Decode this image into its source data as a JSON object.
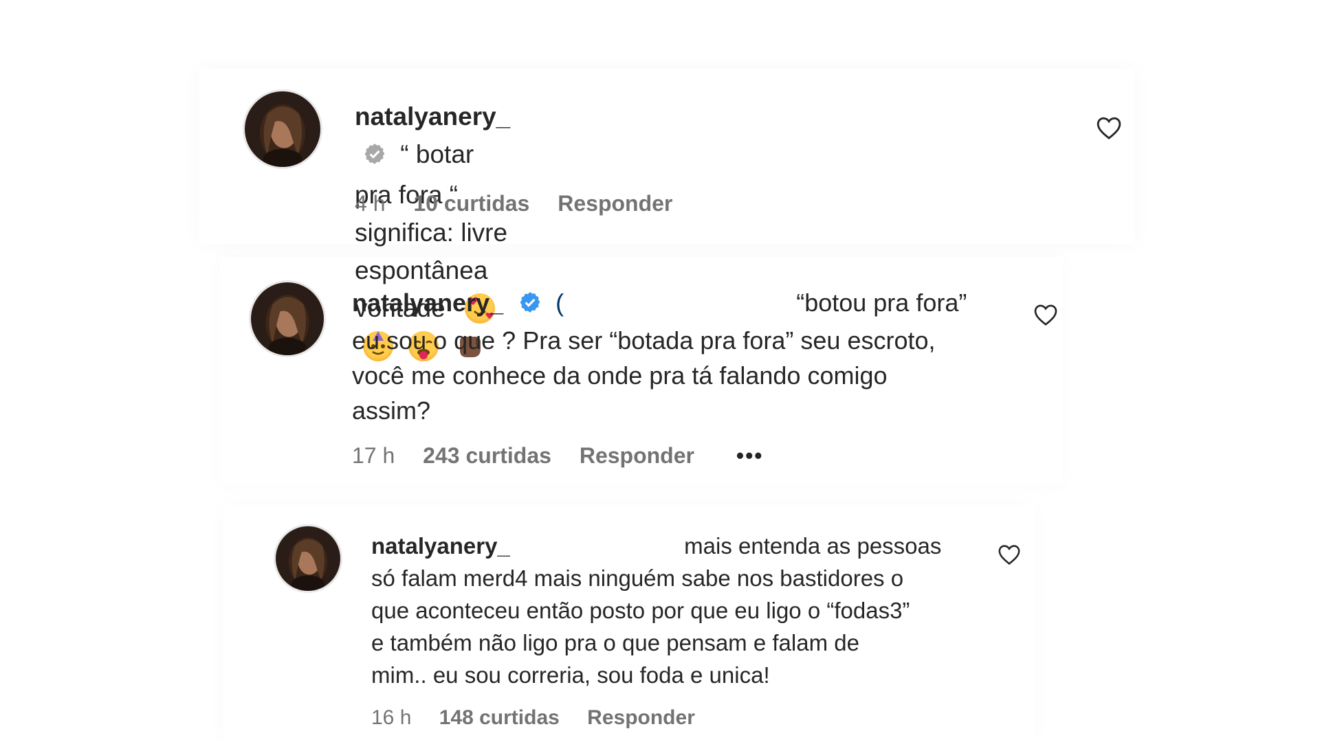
{
  "comments": [
    {
      "username": "natalyanery_",
      "text_line1": "“ botar pra fora “ significa: livre",
      "text_line2": "espontânea vontade",
      "time": "4 h",
      "likes": "10 curtidas",
      "reply": "Responder"
    },
    {
      "username": "natalyanery_",
      "prefix": "(",
      "text_line1": "“botou pra fora”",
      "text_line2": "eu sou o que ? Pra ser “botada pra fora” seu escroto,",
      "text_line3": "você me conhece da onde pra tá falando comigo",
      "text_line4": "assim?",
      "time": "17 h",
      "likes": "243 curtidas",
      "reply": "Responder",
      "more": "•••"
    },
    {
      "username": "natalyanery_",
      "text_line1": "mais entenda as pessoas",
      "text_line2": "só falam merd4 mais ninguém sabe nos bastidores o",
      "text_line3": "que aconteceu então posto por que eu ligo o “fodas3”",
      "text_line4": "e também não ligo pra o que pensam e falam de",
      "text_line5": "mim.. eu sou correria, sou foda e unica!",
      "time": "16 h",
      "likes": "148 curtidas",
      "reply": "Responder"
    }
  ],
  "colors": {
    "verified_blue": "#3897f0",
    "verified_gray": "#a8a8a8",
    "meta_gray": "#737373",
    "text": "#262626"
  },
  "icons": {
    "like": "heart-outline-icon",
    "verified": "verified-badge-icon"
  }
}
